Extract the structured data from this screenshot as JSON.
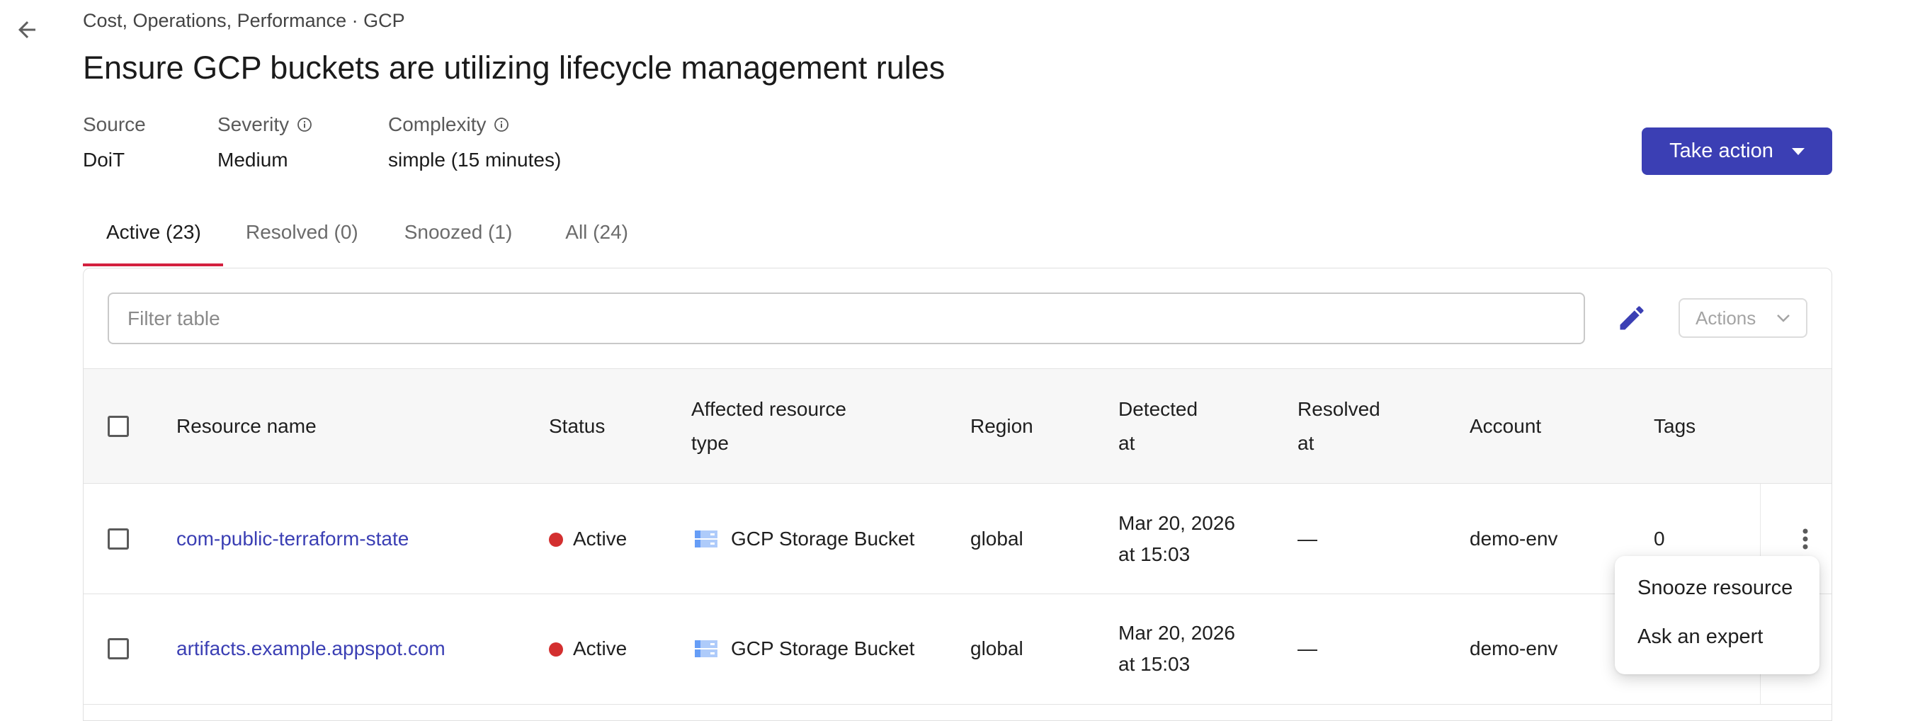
{
  "header": {
    "breadcrumb": "Cost, Operations, Performance · GCP",
    "title": "Ensure GCP buckets are utilizing lifecycle management rules",
    "back_icon": "arrow-left-icon"
  },
  "meta": {
    "source": {
      "label": "Source",
      "value": "DoiT"
    },
    "severity": {
      "label": "Severity",
      "value": "Medium"
    },
    "complexity": {
      "label": "Complexity",
      "value": "simple (15 minutes)"
    }
  },
  "take_action": {
    "label": "Take action"
  },
  "tabs": [
    {
      "label": "Active (23)",
      "active": true
    },
    {
      "label": "Resolved (0)",
      "active": false
    },
    {
      "label": "Snoozed (1)",
      "active": false
    },
    {
      "label": "All (24)",
      "active": false
    }
  ],
  "toolbar": {
    "filter_placeholder": "Filter table",
    "actions_label": "Actions"
  },
  "table": {
    "columns": {
      "resource_name": "Resource name",
      "status": "Status",
      "affected_type_1": "Affected resource",
      "affected_type_2": "type",
      "region": "Region",
      "detected_1": "Detected",
      "detected_2": "at",
      "resolved_1": "Resolved",
      "resolved_2": "at",
      "account": "Account",
      "tags": "Tags"
    },
    "rows": [
      {
        "resource_name": "com-public-terraform-state",
        "status": "Active",
        "type": "GCP Storage Bucket",
        "region": "global",
        "detected_date": "Mar 20, 2026",
        "detected_time": "at 15:03",
        "resolved": "—",
        "account": "demo-env",
        "tags": "0"
      },
      {
        "resource_name": "artifacts.example.appspot.com",
        "status": "Active",
        "type": "GCP Storage Bucket",
        "region": "global",
        "detected_date": "Mar 20, 2026",
        "detected_time": "at 15:03",
        "resolved": "—",
        "account": "demo-env",
        "tags": ""
      }
    ]
  },
  "row_menu": {
    "items": [
      "Snooze resource",
      "Ask an expert"
    ]
  },
  "colors": {
    "primary": "#3b3fb4",
    "tab_indicator": "#d3203f",
    "status_active": "#d32f2f"
  }
}
